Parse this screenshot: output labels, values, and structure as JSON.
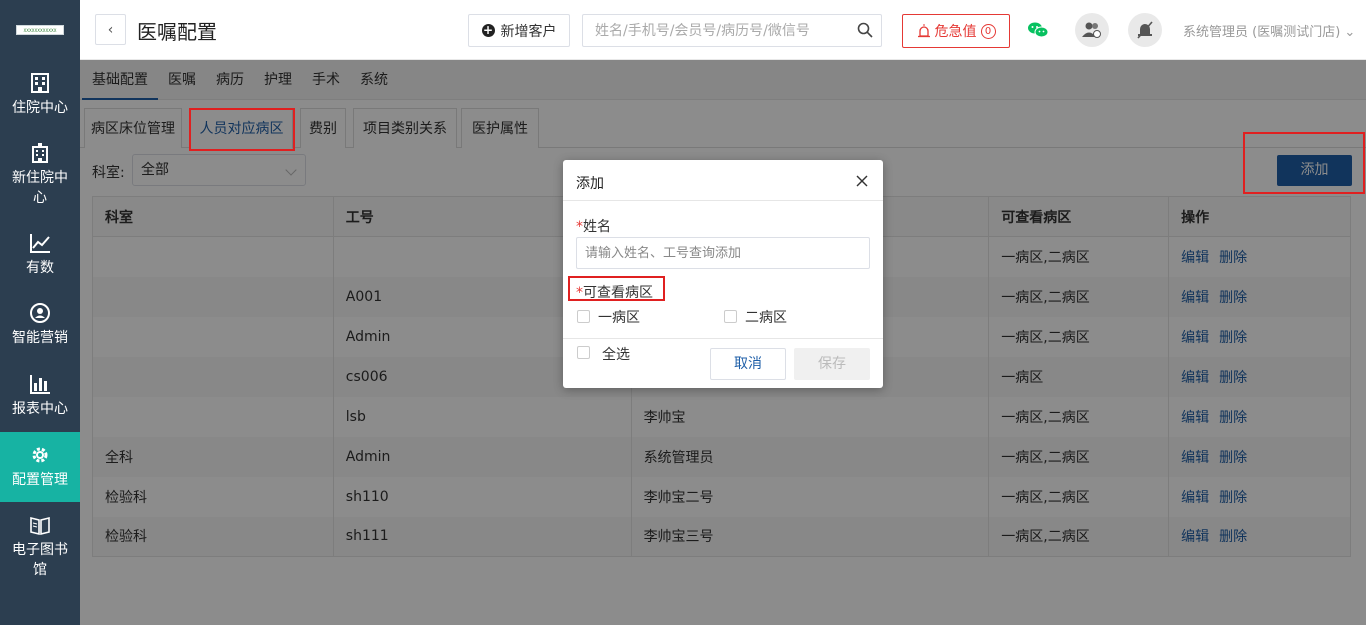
{
  "sidebar": {
    "logo_text": "XXXXXXXXXXXX",
    "items": [
      {
        "label": "住院中心",
        "icon": "hospital-building-icon"
      },
      {
        "label": "新住院中心",
        "icon": "new-hospital-icon"
      },
      {
        "label": "有数",
        "icon": "trend-chart-icon"
      },
      {
        "label": "智能营销",
        "icon": "marketing-icon"
      },
      {
        "label": "报表中心",
        "icon": "bar-chart-icon"
      },
      {
        "label": "配置管理",
        "icon": "gear-icon",
        "active": true
      },
      {
        "label": "电子图书馆",
        "icon": "book-icon"
      }
    ]
  },
  "header": {
    "back_label": "‹",
    "title": "医嘱配置",
    "new_customer_label": "新增客户",
    "search_placeholder": "姓名/手机号/会员号/病历号/微信号",
    "alert_label": "危急值",
    "alert_count": "0",
    "user_label": "系统管理员 (医嘱测试门店)"
  },
  "top_tabs": [
    "基础配置",
    "医嘱",
    "病历",
    "护理",
    "手术",
    "系统"
  ],
  "sub_tabs": [
    "病区床位管理",
    "人员对应病区",
    "费别",
    "项目类别关系",
    "医护属性"
  ],
  "filter": {
    "label": "科室:",
    "value": "全部"
  },
  "add_button_label": "添加",
  "table": {
    "headers": [
      "科室",
      "工号",
      "",
      "可查看病区",
      "操作"
    ],
    "edit_label": "编辑",
    "delete_label": "删除",
    "rows": [
      {
        "dept": "",
        "id": "",
        "name": "",
        "wards": "一病区,二病区"
      },
      {
        "dept": "",
        "id": "A001",
        "name": "",
        "wards": "一病区,二病区"
      },
      {
        "dept": "",
        "id": "Admin",
        "name": "",
        "wards": "一病区,二病区"
      },
      {
        "dept": "",
        "id": "cs006",
        "name": "",
        "wards": "一病区"
      },
      {
        "dept": "",
        "id": "lsb",
        "name": "李帅宝",
        "wards": "一病区,二病区"
      },
      {
        "dept": "全科",
        "id": "Admin",
        "name": "系统管理员",
        "wards": "一病区,二病区"
      },
      {
        "dept": "检验科",
        "id": "sh110",
        "name": "李帅宝二号",
        "wards": "一病区,二病区"
      },
      {
        "dept": "检验科",
        "id": "sh111",
        "name": "李帅宝三号",
        "wards": "一病区,二病区"
      }
    ]
  },
  "dialog": {
    "title": "添加",
    "name_label": "姓名",
    "name_placeholder": "请输入姓名、工号查询添加",
    "wards_label": "可查看病区",
    "ward_options": [
      "一病区",
      "二病区"
    ],
    "select_all_label": "全选",
    "cancel_label": "取消",
    "save_label": "保存"
  }
}
